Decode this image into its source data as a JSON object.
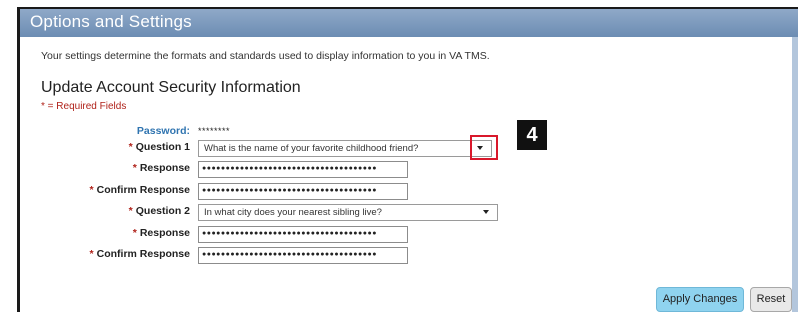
{
  "header": {
    "title": "Options and Settings"
  },
  "intro_text": "Your settings determine the formats and standards used to display information to you in VA TMS.",
  "section": {
    "title": "Update Account Security Information",
    "required_note": "* = Required Fields"
  },
  "form": {
    "password": {
      "label": "Password:",
      "value": "********"
    },
    "question1": {
      "label": "Question 1",
      "selected": "What is the name of your favorite childhood friend?"
    },
    "response1": {
      "label": "Response",
      "masked": "●●●●●●●●●●●●●●●●●●●●●●●●●●●●●●●●●●●●●"
    },
    "confirm1": {
      "label": "Confirm Response",
      "masked": "●●●●●●●●●●●●●●●●●●●●●●●●●●●●●●●●●●●●●"
    },
    "question2": {
      "label": "Question 2",
      "selected": "In what city does your nearest sibling live?"
    },
    "response2": {
      "label": "Response",
      "masked": "●●●●●●●●●●●●●●●●●●●●●●●●●●●●●●●●●●●●●"
    },
    "confirm2": {
      "label": "Confirm Response",
      "masked": "●●●●●●●●●●●●●●●●●●●●●●●●●●●●●●●●●●●●●"
    },
    "required_marker": "*"
  },
  "callout": {
    "number": "4",
    "color": "#d9182b"
  },
  "buttons": {
    "apply": "Apply Changes",
    "reset": "Reset"
  },
  "colors": {
    "header_bar": "#7a99bd",
    "required": "#b0221a",
    "password_label": "#2f74b0",
    "apply_button": "#8fd3ef"
  }
}
